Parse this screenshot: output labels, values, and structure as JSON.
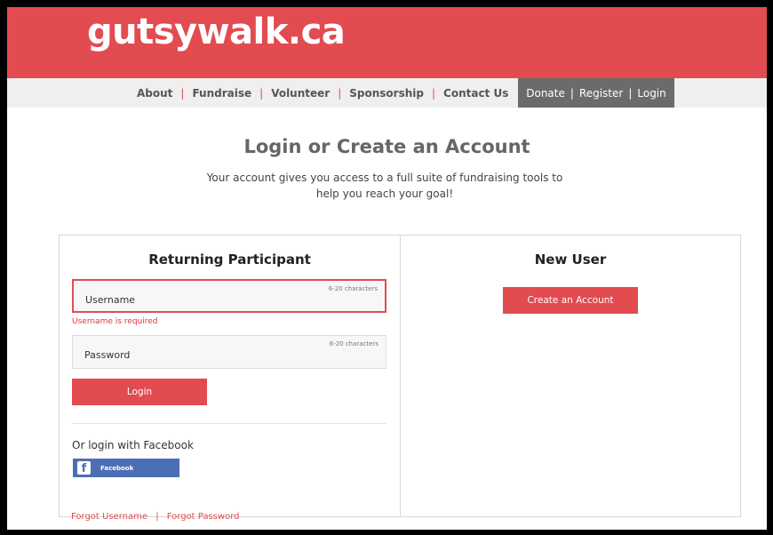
{
  "header": {
    "logo": "gutsywalk.ca"
  },
  "nav": {
    "links": [
      "About",
      "Fundraise",
      "Volunteer",
      "Sponsorship",
      "Contact Us"
    ],
    "separator": "|",
    "account": [
      "Donate",
      "Register",
      "Login"
    ]
  },
  "main": {
    "title": "Login or Create an Account",
    "intro": "Your account gives you access to a full suite of fundraising tools to help you reach your goal!"
  },
  "returning": {
    "title": "Returning Participant",
    "username": {
      "placeholder": "Username",
      "hint": "6-20 characters",
      "error": "Username is required"
    },
    "password": {
      "placeholder": "Password",
      "hint": "6-20 characters"
    },
    "login_button": "Login",
    "facebook_label": "Or login with Facebook",
    "facebook_button": "Facebook",
    "facebook_glyph": "f",
    "forgot_username": "Forgot  Username",
    "forgot_password": "Forgot  Password"
  },
  "new_user": {
    "title": "New User",
    "create_button": "Create an Account"
  },
  "colors": {
    "brand": "#e24b4f",
    "nav_bg": "#efefef",
    "account_bg": "#6b6b6b",
    "facebook": "#4c6eb5"
  }
}
